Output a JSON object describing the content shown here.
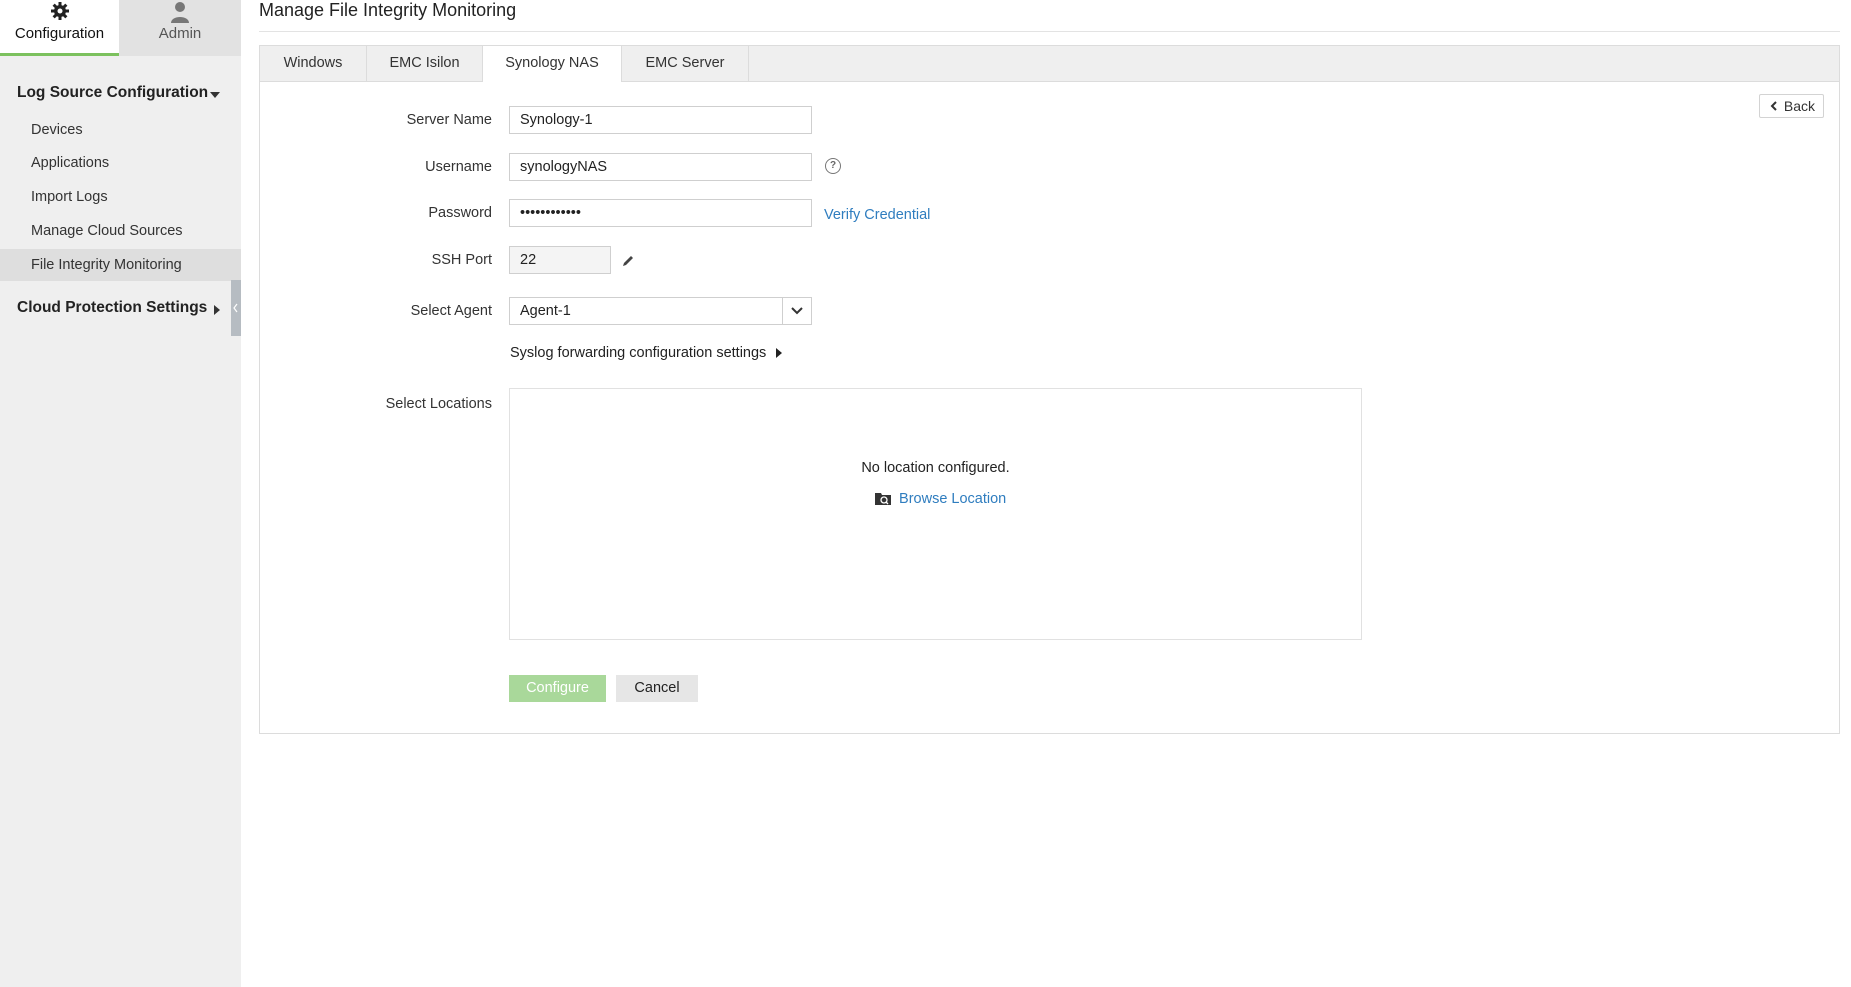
{
  "sidebar": {
    "top_tabs": [
      {
        "label": "Configuration",
        "icon": "gear-icon"
      },
      {
        "label": "Admin",
        "icon": "user-icon"
      }
    ],
    "section1": "Log Source Configuration",
    "items": [
      {
        "label": "Devices"
      },
      {
        "label": "Applications"
      },
      {
        "label": "Import Logs"
      },
      {
        "label": "Manage Cloud Sources"
      },
      {
        "label": "File Integrity Monitoring"
      }
    ],
    "section2": "Cloud Protection Settings"
  },
  "page": {
    "title": "Manage File Integrity Monitoring",
    "tabs": [
      "Windows",
      "EMC Isilon",
      "Synology NAS",
      "EMC Server"
    ],
    "active_tab": "Synology NAS",
    "back_label": "Back"
  },
  "form": {
    "server_name_label": "Server Name",
    "server_name_value": "Synology-1",
    "username_label": "Username",
    "username_value": "synologyNAS",
    "password_label": "Password",
    "password_value": "••••••••••••",
    "verify_label": "Verify Credential",
    "ssh_port_label": "SSH Port",
    "ssh_port_value": "22",
    "agent_label": "Select Agent",
    "agent_value": "Agent-1",
    "syslog_label": "Syslog forwarding configuration settings",
    "locations_label": "Select Locations",
    "no_location": "No location configured.",
    "browse_label": "Browse Location",
    "configure_label": "Configure",
    "cancel_label": "Cancel"
  },
  "colors": {
    "accent_green": "#7cc15e",
    "link_blue": "#2f7dbf",
    "primary_button": "#a9d89a"
  }
}
